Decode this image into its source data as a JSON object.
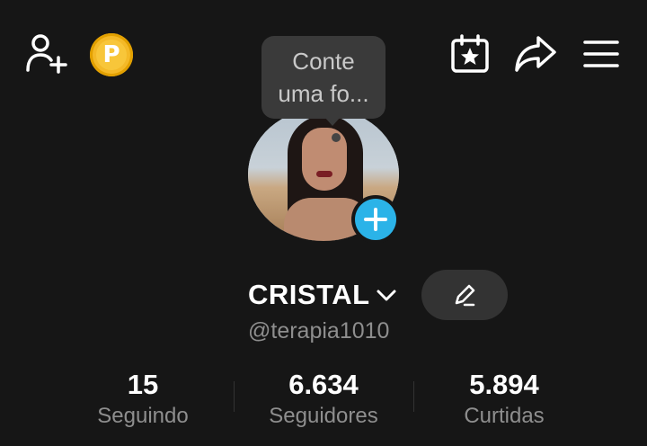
{
  "header": {
    "add_friend_icon": "person-add-icon",
    "coin_icon": "coin-icon",
    "coin_letter": "P",
    "calendar_icon": "calendar-star-icon",
    "share_icon": "share-icon",
    "menu_icon": "hamburger-menu-icon"
  },
  "profile": {
    "tooltip": "Conte uma fo...",
    "username": "CRISTAL",
    "handle": "@terapia1010",
    "accent_color": "#2bb3e8",
    "coin_color": "#f4b928"
  },
  "stats": [
    {
      "value": "15",
      "label": "Seguindo"
    },
    {
      "value": "6.634",
      "label": "Seguidores"
    },
    {
      "value": "5.894",
      "label": "Curtidas"
    }
  ]
}
